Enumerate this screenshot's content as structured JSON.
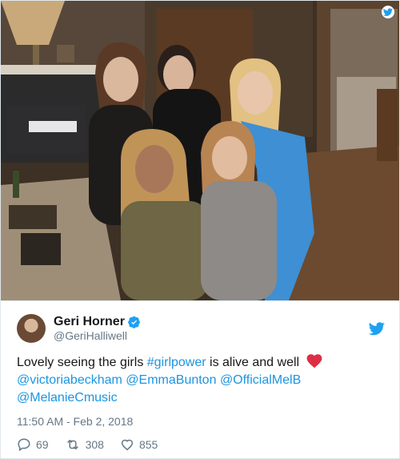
{
  "photo": {
    "alt_icon": "twitter-logo-badge",
    "wall_color": "#4a3a2c",
    "floor_color": "#6b4a2f"
  },
  "user": {
    "display_name": "Geri Horner",
    "handle": "@GeriHalliwell",
    "verified_icon": "verified-badge-icon"
  },
  "tweet": {
    "text_prefix": "Lovely seeing the girls ",
    "hashtag": "#girlpower",
    "text_suffix": " is alive and well",
    "emoji": "red-heart",
    "mentions": [
      "@victoriabeckham",
      "@EmmaBunton",
      "@OfficialMelB",
      "@MelanieCmusic"
    ],
    "timestamp": "11:50 AM - Feb 2, 2018"
  },
  "stats": {
    "replies": "69",
    "retweets": "308",
    "likes": "855"
  },
  "colors": {
    "link": "#1b95e0",
    "muted": "#657786",
    "verified": "#1da1f2",
    "heart": "#e0245e"
  }
}
